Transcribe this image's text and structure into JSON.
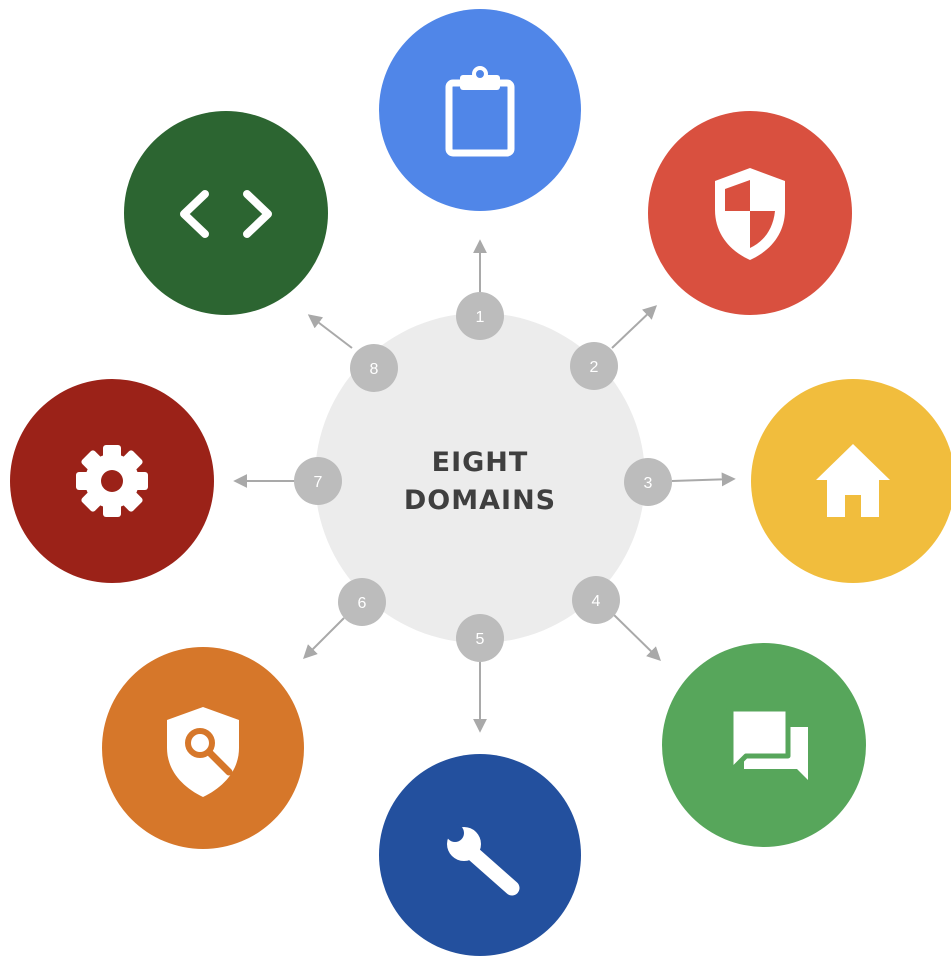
{
  "title_lines": [
    "EIGHT",
    "DOMAINS"
  ],
  "domains": [
    {
      "number": "1",
      "icon": "clipboard-icon",
      "color": "#5086e8"
    },
    {
      "number": "2",
      "icon": "security-shield-icon",
      "color": "#d9503f"
    },
    {
      "number": "3",
      "icon": "home-icon",
      "color": "#f1bd3d"
    },
    {
      "number": "4",
      "icon": "chat-bubbles-icon",
      "color": "#57a65b"
    },
    {
      "number": "5",
      "icon": "wrench-icon",
      "color": "#23509e"
    },
    {
      "number": "6",
      "icon": "shield-search-icon",
      "color": "#d6772a"
    },
    {
      "number": "7",
      "icon": "gear-icon",
      "color": "#9b2218"
    },
    {
      "number": "8",
      "icon": "code-brackets-icon",
      "color": "#2c6531"
    }
  ],
  "colors": {
    "hub": "#ececec",
    "badge": "#bcbcbc",
    "arrow": "#a9a9a9",
    "title": "#3f3f3f"
  }
}
